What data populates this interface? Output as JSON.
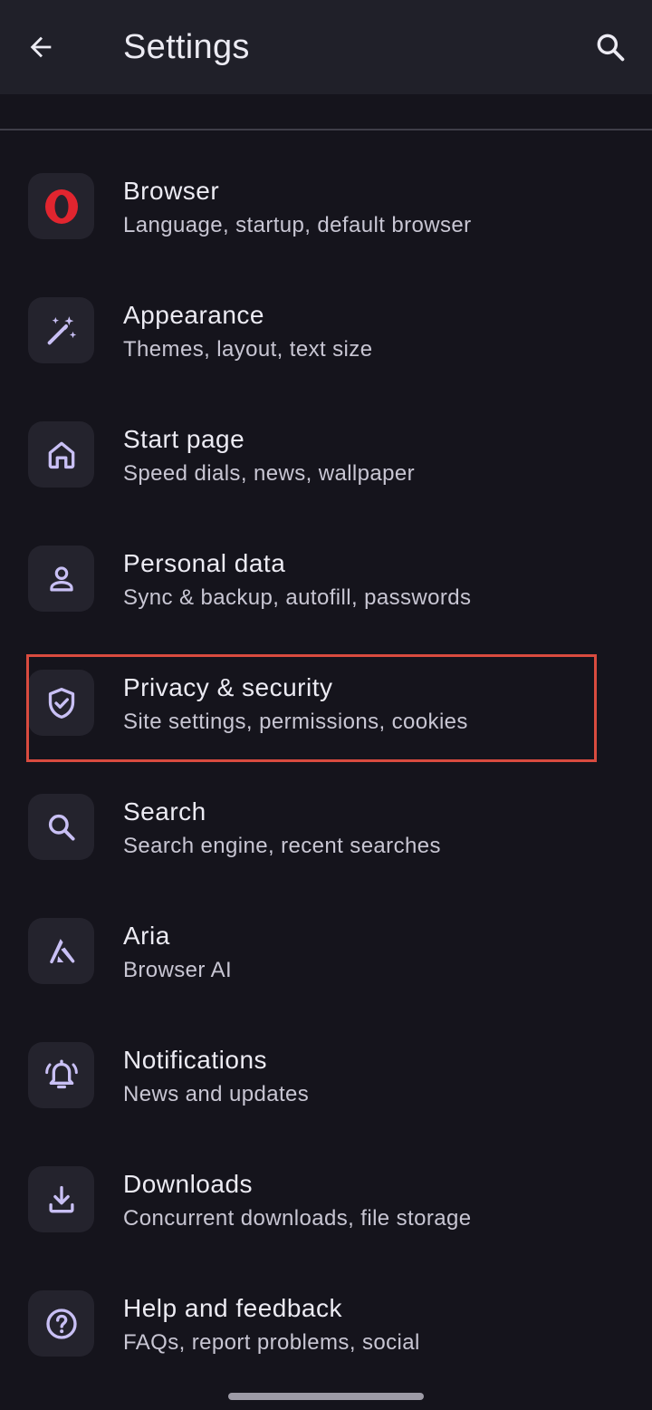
{
  "app_bar": {
    "title": "Settings",
    "back_icon": "arrow-back-icon",
    "search_icon": "search-icon"
  },
  "colors": {
    "background": "#15141c",
    "app_bar": "#202029",
    "icon_tile": "#24232d",
    "icon_accent": "#c9c0f5",
    "opera_red": "#e1252f",
    "highlight_border": "#d94b3f"
  },
  "items": [
    {
      "title": "Browser",
      "subtitle": "Language, startup, default browser",
      "icon": "opera-logo-icon"
    },
    {
      "title": "Appearance",
      "subtitle": "Themes, layout, text size",
      "icon": "magic-wand-icon"
    },
    {
      "title": "Start page",
      "subtitle": "Speed dials, news, wallpaper",
      "icon": "home-icon"
    },
    {
      "title": "Personal data",
      "subtitle": "Sync & backup, autofill, passwords",
      "icon": "person-icon"
    },
    {
      "title": "Privacy & security",
      "subtitle": "Site settings, permissions, cookies",
      "icon": "shield-check-icon",
      "highlighted": true
    },
    {
      "title": "Search",
      "subtitle": "Search engine, recent searches",
      "icon": "search-icon"
    },
    {
      "title": "Aria",
      "subtitle": "Browser AI",
      "icon": "aria-icon"
    },
    {
      "title": "Notifications",
      "subtitle": "News and updates",
      "icon": "bell-ringing-icon"
    },
    {
      "title": "Downloads",
      "subtitle": "Concurrent downloads, file storage",
      "icon": "download-icon"
    },
    {
      "title": "Help and feedback",
      "subtitle": "FAQs, report problems, social",
      "icon": "help-circle-icon"
    }
  ]
}
